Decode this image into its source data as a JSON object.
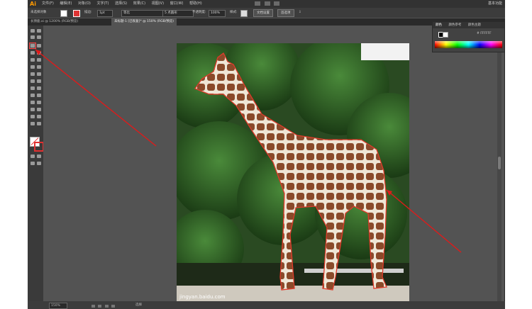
{
  "app": {
    "logo": "Ai",
    "workspace": "基本功能"
  },
  "menubar": {
    "items": [
      "文件(F)",
      "编辑(E)",
      "对象(O)",
      "文字(T)",
      "选择(S)",
      "效果(C)",
      "视图(V)",
      "窗口(W)",
      "帮助(H)"
    ]
  },
  "control_bar": {
    "selection_label": "未选择对象",
    "stroke_label": "描边:",
    "stroke_value": "1pt",
    "stroke_style": "等比",
    "brush_value": "5 点圆形",
    "opacity_label": "不透明度:",
    "opacity_value": "100%",
    "style_label": "样式:",
    "doc_setup_button": "文档设置",
    "preferences_button": "首选项"
  },
  "tabs": [
    {
      "label": "长颈鹿.ai @ 1200% (RGB/预览)"
    },
    {
      "label": "未标题-1 [已恢复]* @ 150% (RGB/预览)"
    }
  ],
  "color_panel": {
    "tabs": [
      "颜色",
      "颜色参考",
      "颜色主题"
    ],
    "hex": "# FFFFFF"
  },
  "status_bar": {
    "zoom": "150%",
    "selection_tool": "选择"
  },
  "watermark": "jingyan.baidu.com",
  "colors": {
    "annotation_arrow": "#e01a1a",
    "outline": "#e03a2a",
    "ui_dark": "#323232",
    "ui_mid": "#535353"
  }
}
